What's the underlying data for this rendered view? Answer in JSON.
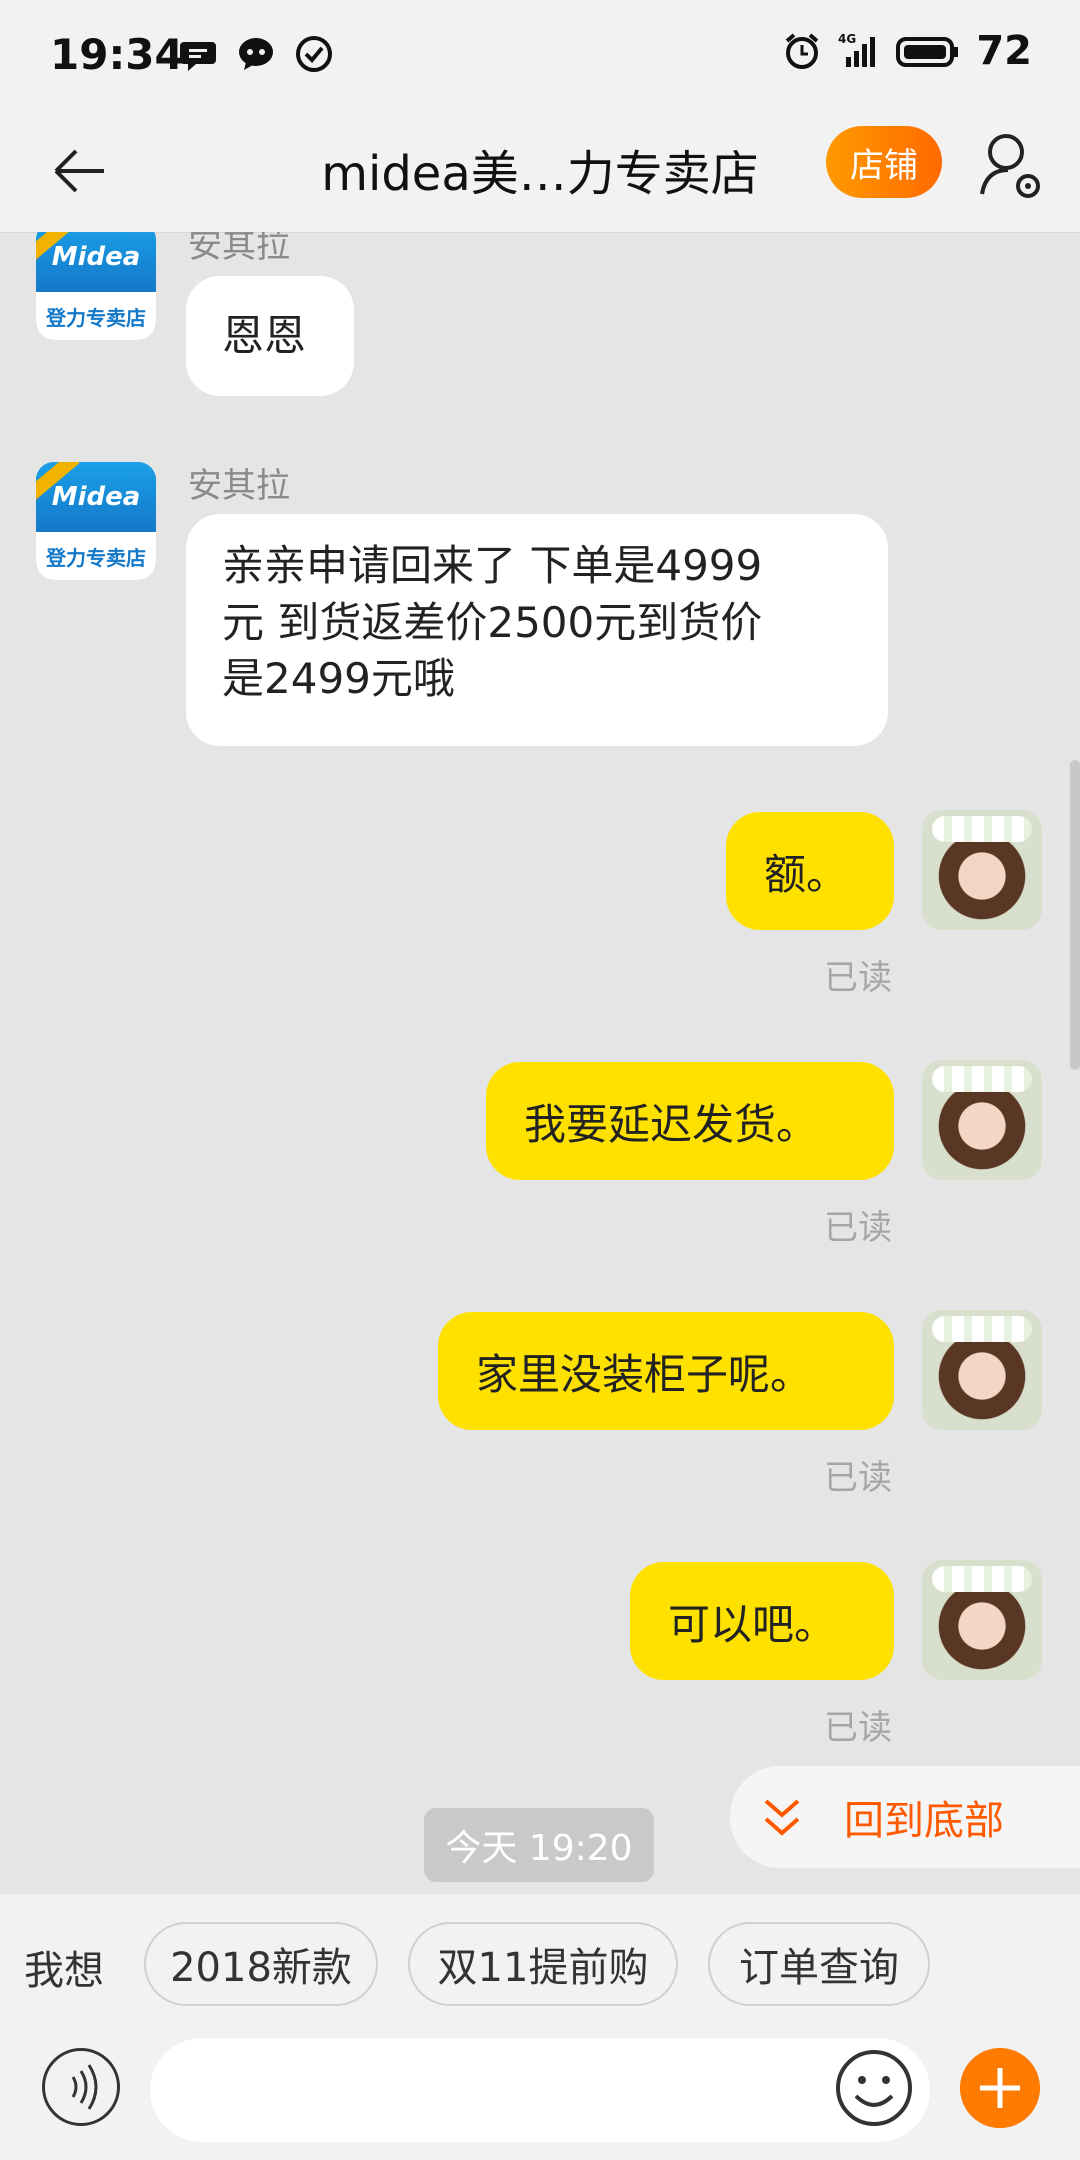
{
  "status_bar": {
    "time": "19:34",
    "network": "4G",
    "battery": "72",
    "icons": [
      "message-bubble-icon",
      "chat-bot-icon",
      "check-circle-icon",
      "alarm-icon",
      "signal-icon",
      "battery-icon"
    ]
  },
  "header": {
    "title": "midea美…力专卖店",
    "shop_button": "店铺"
  },
  "shop_avatar": {
    "logo_text": "Midea",
    "caption": "登力专卖店"
  },
  "messages": {
    "m1": {
      "sender": "安其拉",
      "text": "恩恩"
    },
    "m2": {
      "sender": "安其拉",
      "line1": "亲亲申请回来了 下单是4999",
      "line2": "元 到货返差价2500元到货价",
      "line3": "是2499元哦"
    },
    "m3": {
      "text": "额。",
      "status": "已读"
    },
    "m4": {
      "text": "我要延迟发货。",
      "status": "已读"
    },
    "m5": {
      "text": "家里没装柜子呢。",
      "status": "已读"
    },
    "m6": {
      "text": "可以吧。",
      "status": "已读"
    }
  },
  "time_divider": "今天  19:20",
  "back_to_bottom": "回到底部",
  "quick_bar": {
    "label": "我想",
    "chips": [
      "2018新款",
      "双11提前购",
      "订单查询"
    ]
  },
  "input": {
    "placeholder": ""
  },
  "colors": {
    "accent": "#ff6a00",
    "bubble_self": "#ffe100",
    "background": "#e5e5e5"
  }
}
